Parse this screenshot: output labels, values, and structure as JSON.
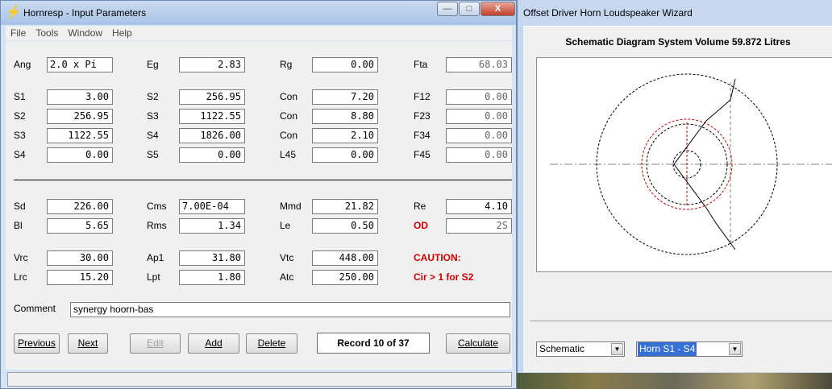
{
  "main_window": {
    "title": "Hornresp - Input Parameters",
    "icon": "lightning-icon",
    "controls": {
      "minimize": "—",
      "maximize": "□",
      "close": "X"
    },
    "menu": [
      "File",
      "Tools",
      "Window",
      "Help"
    ]
  },
  "params": {
    "row_ang": {
      "ang_label": "Ang",
      "ang": "2.0 x Pi",
      "eg_label": "Eg",
      "eg": "2.83",
      "rg_label": "Rg",
      "rg": "0.00",
      "fta_label": "Fta",
      "fta": "68.03"
    },
    "row1": {
      "a_label": "S1",
      "a": "3.00",
      "b_label": "S2",
      "b": "256.95",
      "c_label": "Con",
      "c": "7.20",
      "d_label": "F12",
      "d": "0.00"
    },
    "row2": {
      "a_label": "S2",
      "a": "256.95",
      "b_label": "S3",
      "b": "1122.55",
      "c_label": "Con",
      "c": "8.80",
      "d_label": "F23",
      "d": "0.00"
    },
    "row3": {
      "a_label": "S3",
      "a": "1122.55",
      "b_label": "S4",
      "b": "1826.00",
      "c_label": "Con",
      "c": "2.10",
      "d_label": "F34",
      "d": "0.00"
    },
    "row4": {
      "a_label": "S4",
      "a": "0.00",
      "b_label": "S5",
      "b": "0.00",
      "c_label": "L45",
      "c": "0.00",
      "d_label": "F45",
      "d": "0.00"
    },
    "row5": {
      "a_label": "Sd",
      "a": "226.00",
      "b_label": "Cms",
      "b": "7.00E-04",
      "c_label": "Mmd",
      "c": "21.82",
      "d_label": "Re",
      "d": "4.10"
    },
    "row6": {
      "a_label": "Bl",
      "a": "5.65",
      "b_label": "Rms",
      "b": "1.34",
      "c_label": "Le",
      "c": "0.50",
      "d_label": "OD",
      "d": "2S"
    },
    "row7": {
      "a_label": "Vrc",
      "a": "30.00",
      "b_label": "Ap1",
      "b": "31.80",
      "c_label": "Vtc",
      "c": "448.00",
      "d_label": "CAUTION:"
    },
    "row8": {
      "a_label": "Lrc",
      "a": "15.20",
      "b_label": "Lpt",
      "b": "1.80",
      "c_label": "Atc",
      "c": "250.00",
      "d_label": "Cir > 1 for S2"
    }
  },
  "comment": {
    "label": "Comment",
    "value": "synergy hoorn-bas"
  },
  "buttons": {
    "previous": "Previous",
    "next": "Next",
    "edit": "Edit",
    "add": "Add",
    "delete": "Delete",
    "record": "Record 10 of 37",
    "calculate": "Calculate"
  },
  "wizard": {
    "title": "Offset Driver Horn Loudspeaker Wizard",
    "heading": "Schematic Diagram   System Volume 59.872 Litres",
    "view_select": "Schematic",
    "segment_select": "Horn S1 - S4"
  },
  "colors": {
    "title_bg": "#a9c3e6",
    "client_bg": "#f0f0f0",
    "caution_red": "#d00000",
    "selection_blue": "#3470d6"
  }
}
